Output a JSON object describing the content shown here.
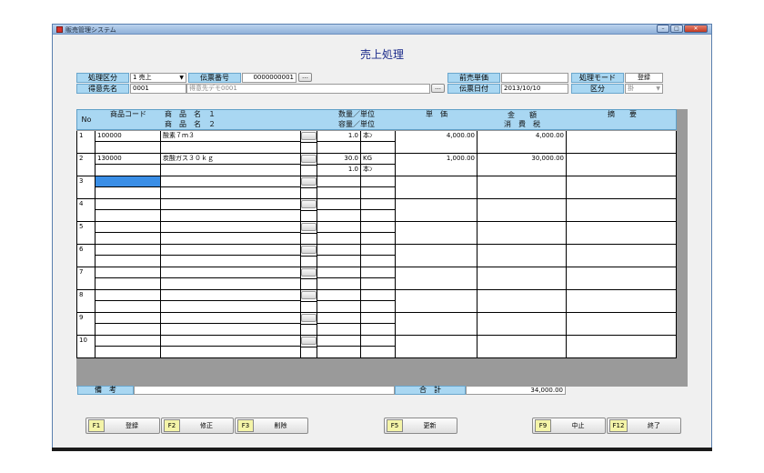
{
  "window": {
    "title": "販売管理システム"
  },
  "screen_title": "売上処理",
  "header": {
    "shori_kubun_label": "処理区分",
    "shori_kubun_value": "1 売上",
    "denpyo_no_label": "伝票番号",
    "denpyo_no_value": "0000000001",
    "tokuisaki_label": "得意先名",
    "tokuisaki_code": "0001",
    "tokuisaki_name": "得意先デモ0001",
    "zen_uri_label": "前売単価",
    "zen_uri_value": "",
    "denpyo_date_label": "伝票日付",
    "denpyo_date_value": "2013/10/10",
    "mode_label": "処理モード",
    "mode_value": "登録",
    "kubun_label": "区分",
    "kubun_value": "掛",
    "dot_button": "…"
  },
  "grid_header": {
    "no": "No",
    "code": "商品コード",
    "name1": "商　品　名　１",
    "name2": "商　品　名　２",
    "qty_unit": "数量／単位",
    "cap_unit": "容量／単位",
    "price": "単　価",
    "amount": "金　　額",
    "tax": "消　費　税",
    "memo": "摘　　要"
  },
  "rows": [
    {
      "no": "1",
      "code": "100000",
      "name1": "酸素７ｍ３",
      "name2": "",
      "qty": "1.0",
      "unit": "本ﾝ",
      "cap": "",
      "cap_unit": "",
      "price": "4,000.00",
      "amount": "4,000.00",
      "tax": "",
      "memo": ""
    },
    {
      "no": "2",
      "code": "130000",
      "name1": "炭酸ガス３０ｋｇ",
      "name2": "",
      "qty": "30.0",
      "unit": "KG",
      "cap": "1.0",
      "cap_unit": "本ﾝ",
      "price": "1,000.00",
      "amount": "30,000.00",
      "tax": "",
      "memo": ""
    },
    {
      "no": "3",
      "code": "",
      "name1": "",
      "name2": "",
      "qty": "",
      "unit": "",
      "cap": "",
      "cap_unit": "",
      "price": "",
      "amount": "",
      "tax": "",
      "memo": ""
    },
    {
      "no": "4",
      "code": "",
      "name1": "",
      "name2": "",
      "qty": "",
      "unit": "",
      "cap": "",
      "cap_unit": "",
      "price": "",
      "amount": "",
      "tax": "",
      "memo": ""
    },
    {
      "no": "5",
      "code": "",
      "name1": "",
      "name2": "",
      "qty": "",
      "unit": "",
      "cap": "",
      "cap_unit": "",
      "price": "",
      "amount": "",
      "tax": "",
      "memo": ""
    },
    {
      "no": "6",
      "code": "",
      "name1": "",
      "name2": "",
      "qty": "",
      "unit": "",
      "cap": "",
      "cap_unit": "",
      "price": "",
      "amount": "",
      "tax": "",
      "memo": ""
    },
    {
      "no": "7",
      "code": "",
      "name1": "",
      "name2": "",
      "qty": "",
      "unit": "",
      "cap": "",
      "cap_unit": "",
      "price": "",
      "amount": "",
      "tax": "",
      "memo": ""
    },
    {
      "no": "8",
      "code": "",
      "name1": "",
      "name2": "",
      "qty": "",
      "unit": "",
      "cap": "",
      "cap_unit": "",
      "price": "",
      "amount": "",
      "tax": "",
      "memo": ""
    },
    {
      "no": "9",
      "code": "",
      "name1": "",
      "name2": "",
      "qty": "",
      "unit": "",
      "cap": "",
      "cap_unit": "",
      "price": "",
      "amount": "",
      "tax": "",
      "memo": ""
    },
    {
      "no": "10",
      "code": "",
      "name1": "",
      "name2": "",
      "qty": "",
      "unit": "",
      "cap": "",
      "cap_unit": "",
      "price": "",
      "amount": "",
      "tax": "",
      "memo": ""
    }
  ],
  "footer": {
    "biko_label": "備　考",
    "biko_value": "",
    "total_label": "合　計",
    "total_value": "34,000.00"
  },
  "fkeys": [
    {
      "key": "F1",
      "label": "登録"
    },
    {
      "key": "F2",
      "label": "修正"
    },
    {
      "key": "F3",
      "label": "削除"
    },
    {
      "key": "F5",
      "label": "更新"
    },
    {
      "key": "F9",
      "label": "中止"
    },
    {
      "key": "F12",
      "label": "終了"
    }
  ],
  "colors": {
    "label_bg": "#a9d7f2",
    "title": "#1a2a8a",
    "fkey_bg": "#f4f4a8",
    "selected_cell": "#3a8ee6"
  }
}
